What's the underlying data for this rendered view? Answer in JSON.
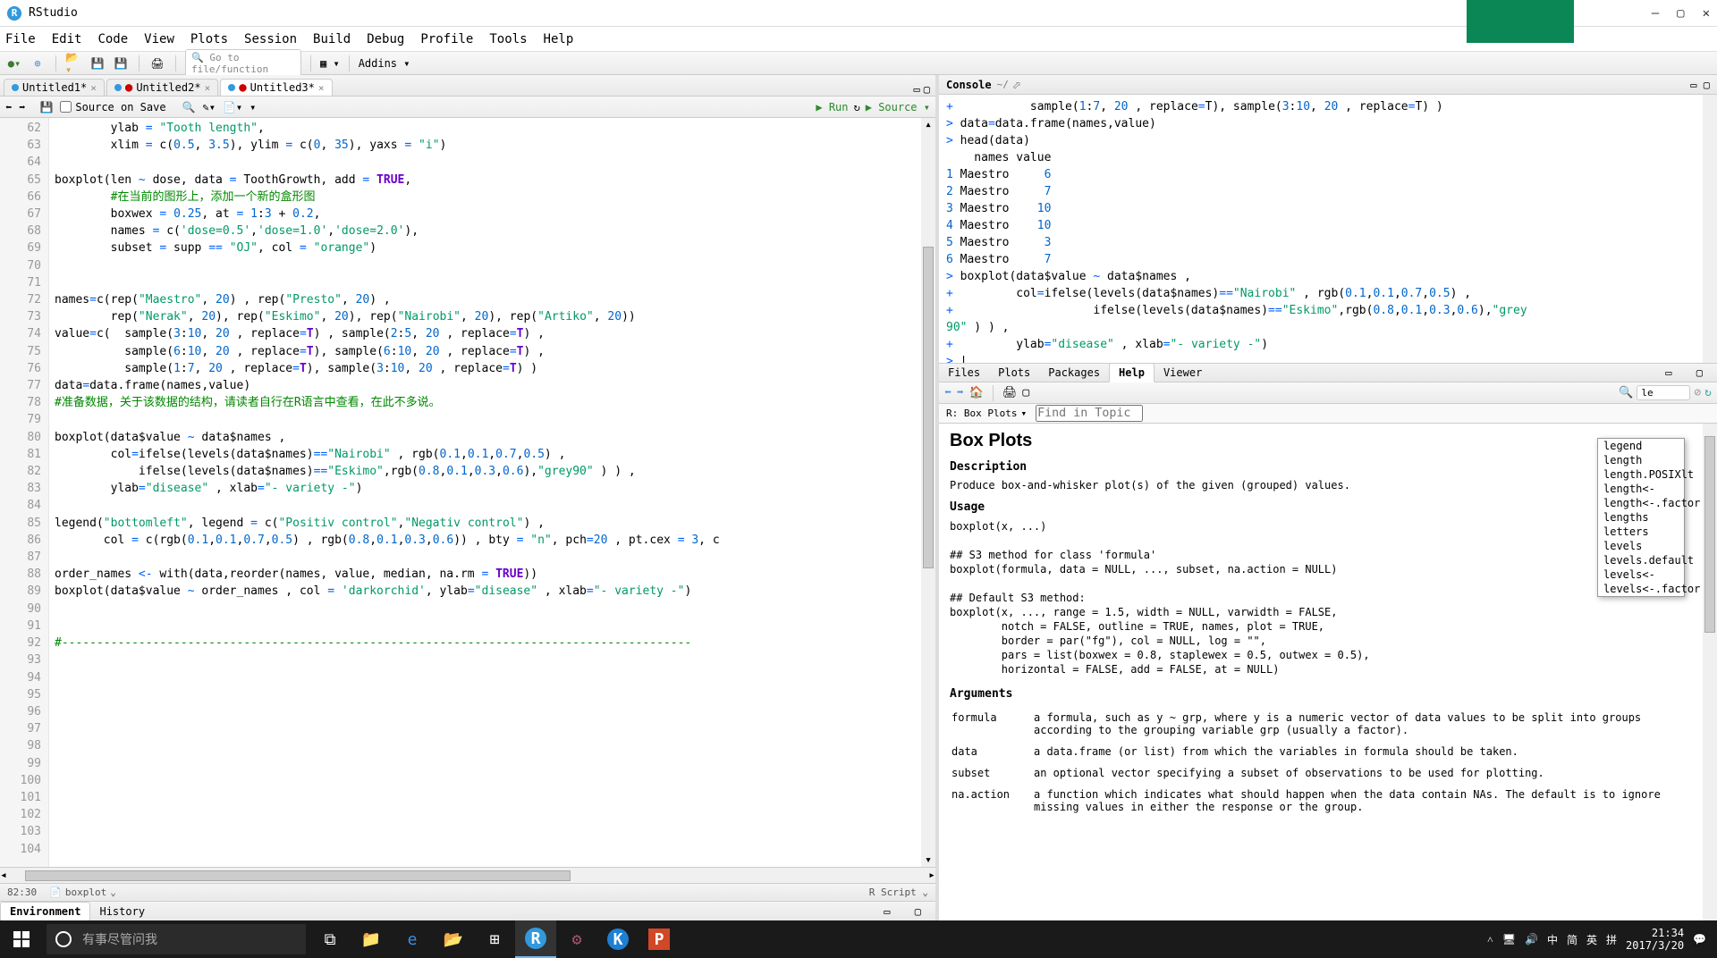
{
  "app": {
    "title": "RStudio"
  },
  "menus": [
    "File",
    "Edit",
    "Code",
    "View",
    "Plots",
    "Session",
    "Build",
    "Debug",
    "Profile",
    "Tools",
    "Help"
  ],
  "toolbar": {
    "gotofile": "Go to file/function",
    "addins": "Addins"
  },
  "tabs": [
    {
      "name": "Untitled1*",
      "active": false
    },
    {
      "name": "Untitled2*",
      "active": false
    },
    {
      "name": "Untitled3*",
      "active": true
    }
  ],
  "src_toolbar": {
    "source_on_save": "Source on Save",
    "run": "Run",
    "source": "Source"
  },
  "editor": {
    "lines": [
      62,
      63,
      64,
      65,
      66,
      67,
      68,
      69,
      70,
      71,
      72,
      73,
      74,
      75,
      76,
      77,
      78,
      79,
      80,
      81,
      82,
      83,
      84,
      85,
      86,
      87,
      88,
      89,
      90,
      91,
      92,
      93,
      94,
      95,
      96,
      97,
      98,
      99,
      100,
      101,
      102,
      103,
      104
    ],
    "status_pos": "82:30",
    "status_func": "boxplot",
    "status_lang": "R Script"
  },
  "console": {
    "title": "Console",
    "path": "~/"
  },
  "bottom_tabs": [
    "Files",
    "Plots",
    "Packages",
    "Help",
    "Viewer"
  ],
  "help": {
    "topic": "R: Box Plots",
    "find_placeholder": "Find in Topic",
    "search_value": "le",
    "title": "Box Plots",
    "desc_h": "Description",
    "desc": "Produce box-and-whisker plot(s) of the given (grouped) values.",
    "usage_h": "Usage",
    "args_h": "Arguments",
    "ac": [
      "legend",
      "length",
      "length.POSIXlt",
      "length<-",
      "length<-.factor",
      "lengths",
      "letters",
      "levels",
      "levels.default",
      "levels<-",
      "levels<-.factor"
    ],
    "args": {
      "formula_t": "a formula, such as y ~ grp, where y is a numeric vector of data values to be split into groups according to the grouping variable grp (usually a factor).",
      "data_t": "a data.frame (or list) from which the variables in formula should be taken.",
      "subset_t": "an optional vector specifying a subset of observations to be used for plotting.",
      "na_t": "a function which indicates what should happen when the data contain NAs. The default is to ignore missing values in either the response or the group."
    }
  },
  "left_bottom_tabs": [
    "Environment",
    "History"
  ],
  "taskbar": {
    "search": "有事尽管问我",
    "ime": [
      "中",
      "简",
      "拼"
    ],
    "lang": "英",
    "time": "21:34",
    "date": "2017/3/20"
  }
}
